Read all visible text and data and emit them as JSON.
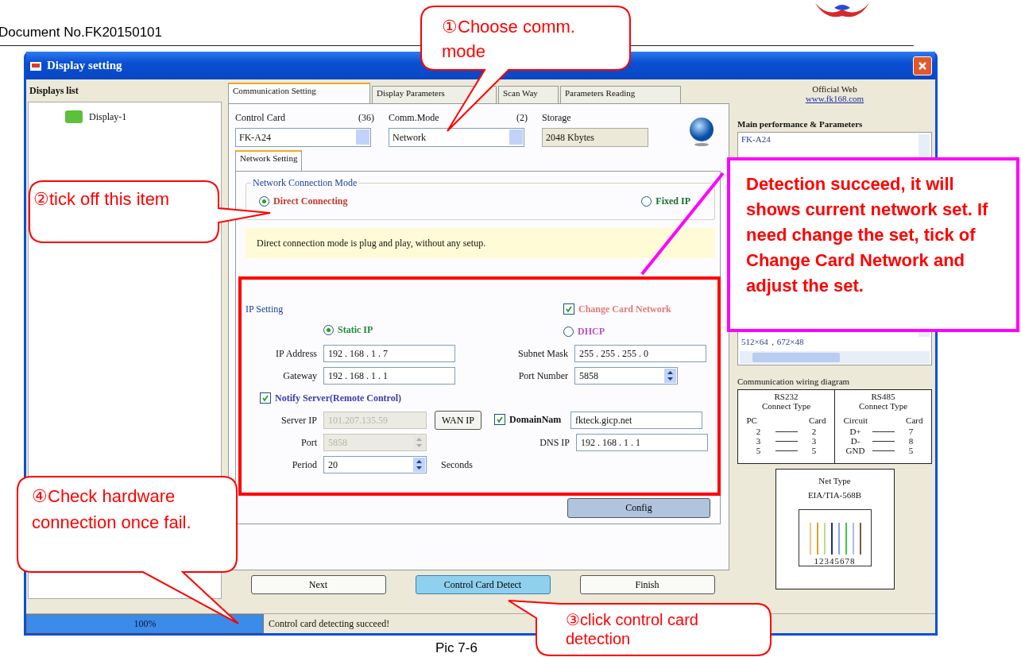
{
  "document": {
    "header": "Document No.FK20150101",
    "caption": "Pic 7-6"
  },
  "window": {
    "title": "Display setting"
  },
  "displays_list": {
    "heading": "Displays list",
    "items": [
      "Display-1"
    ]
  },
  "tabs": [
    {
      "label": "Communication Setting",
      "selected": true
    },
    {
      "label": "Display Parameters",
      "selected": false
    },
    {
      "label": "Scan Way",
      "selected": false
    },
    {
      "label": "Parameters Reading",
      "selected": false
    }
  ],
  "card_row": {
    "control_card": {
      "label": "Control Card",
      "count": "(36)",
      "value": "FK-A24"
    },
    "comm_mode": {
      "label": "Comm.Mode",
      "count": "(2)",
      "value": "Network"
    },
    "storage": {
      "label": "Storage",
      "value": "2048 Kbytes"
    }
  },
  "subtabs": [
    {
      "label": "Network Setting",
      "selected": true
    }
  ],
  "connection_mode": {
    "title": "Network Connection Mode",
    "options": [
      {
        "label": "Direct Connecting",
        "selected": true
      },
      {
        "label": "Fixed IP",
        "selected": false
      }
    ],
    "note": "Direct connection mode is plug and play, without any setup."
  },
  "ip_setting": {
    "title": "IP Setting",
    "change_card_network": {
      "label": "Change Card Network",
      "checked": true
    },
    "modes": [
      {
        "label": "Static IP",
        "selected": true
      },
      {
        "label": "DHCP",
        "selected": false
      }
    ],
    "ip_address": {
      "label": "IP Address",
      "value": "192 . 168 . 1 . 7"
    },
    "subnet_mask": {
      "label": "Subnet Mask",
      "value": "255 . 255 . 255 . 0"
    },
    "gateway": {
      "label": "Gateway",
      "value": "192 . 168 . 1 . 1"
    },
    "port_number": {
      "label": "Port Number",
      "value": "5858"
    },
    "notify_server": {
      "label": "Notify Server(Remote Control)",
      "checked": true
    },
    "server_ip": {
      "label": "Server IP",
      "value": "101.207.135.59",
      "disabled": true
    },
    "wan_ip_button": "WAN IP",
    "domain_name": {
      "label": "DomainNam",
      "checked": true,
      "value": "fkteck.gicp.net"
    },
    "server_port": {
      "label": "Port",
      "value": "5858",
      "disabled": true
    },
    "dns_ip": {
      "label": "DNS IP",
      "value": "192 . 168 . 1 . 1"
    },
    "period": {
      "label": "Period",
      "value": "20",
      "unit": "Seconds"
    }
  },
  "config_button": "Config",
  "buttons": [
    {
      "label": "Next",
      "selected": false
    },
    {
      "label": "Control Card Detect",
      "selected": true
    },
    {
      "label": "Finish",
      "selected": false
    }
  ],
  "status_bar": {
    "progress": {
      "level": 1,
      "label": "100%"
    },
    "message": "Control card detecting succeed!"
  },
  "side_panel": {
    "official_web_label": "Official Web",
    "official_web_link": "www.fk168.com",
    "parameters_heading": "Main performance & Parameters",
    "parameters_lines": [
      "FK-A24",
      "512×64，672×48"
    ],
    "wiring_heading": "Communication wiring diagram",
    "rs232": {
      "title": "RS232",
      "subtitle": "Connect Type",
      "headers": [
        "PC",
        "Card"
      ],
      "rows": [
        [
          "2",
          "2"
        ],
        [
          "3",
          "3"
        ],
        [
          "5",
          "5"
        ]
      ]
    },
    "rs485": {
      "title": "RS485",
      "subtitle": "Connect Type",
      "headers": [
        "Circuit",
        "Card"
      ],
      "rows": [
        [
          "D+",
          "7"
        ],
        [
          "D-",
          "8"
        ],
        [
          "GND",
          "5"
        ]
      ]
    },
    "net_type": {
      "title": "Net Type",
      "standard": "EIA/TIA-568B",
      "pins": "12345678"
    }
  },
  "callouts": [
    {
      "text": "①Choose comm. mode"
    },
    {
      "text": "②tick off this item"
    },
    {
      "text": "③click control card detection"
    },
    {
      "text": "④Check hardware connection once fail."
    }
  ],
  "note": "Detection succeed, it will shows current network set. If need change the set, tick of Change Card Network and adjust the set."
}
